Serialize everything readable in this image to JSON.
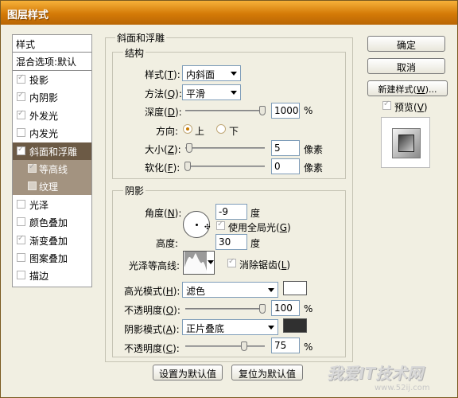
{
  "window": {
    "title": "图层样式"
  },
  "style_list": {
    "header": "样式",
    "blend_default": "混合选项:默认",
    "items": [
      {
        "label": "投影",
        "checked": true
      },
      {
        "label": "内阴影",
        "checked": true
      },
      {
        "label": "外发光",
        "checked": true
      },
      {
        "label": "内发光",
        "checked": false
      },
      {
        "label": "斜面和浮雕",
        "checked": true,
        "selected": true
      },
      {
        "label": "等高线",
        "checked": true,
        "sub": true
      },
      {
        "label": "纹理",
        "checked": false,
        "sub": true
      },
      {
        "label": "光泽",
        "checked": false
      },
      {
        "label": "颜色叠加",
        "checked": false
      },
      {
        "label": "渐变叠加",
        "checked": true
      },
      {
        "label": "图案叠加",
        "checked": false
      },
      {
        "label": "描边",
        "checked": false
      }
    ]
  },
  "bevel": {
    "group_title": "斜面和浮雕",
    "structure": {
      "title": "结构",
      "style_label": "样式(T):",
      "style_value": "内斜面",
      "technique_label": "方法(Q):",
      "technique_value": "平滑",
      "depth_label": "深度(D):",
      "depth_value": "1000",
      "depth_unit": "%",
      "depth_level": 1.0,
      "direction_label": "方向:",
      "direction_up": "上",
      "direction_down": "下",
      "size_label": "大小(Z):",
      "size_value": "5",
      "size_unit": "像素",
      "size_level": 0.02,
      "soften_label": "软化(F):",
      "soften_value": "0",
      "soften_unit": "像素",
      "soften_level": 0.0
    },
    "shading": {
      "title": "阴影",
      "angle_label": "角度(N):",
      "angle_value": "-9",
      "angle_unit": "度",
      "global_light_label": "使用全局光(G)",
      "altitude_label": "高度:",
      "altitude_value": "30",
      "altitude_unit": "度",
      "gloss_contour_label": "光泽等高线:",
      "antialias_label": "消除锯齿(L)",
      "highlight_mode_label": "高光模式(H):",
      "highlight_mode_value": "滤色",
      "highlight_color": "#ffffff",
      "highlight_opacity_label": "不透明度(O):",
      "highlight_opacity_value": "100",
      "highlight_opacity_unit": "%",
      "highlight_opacity_level": 1.0,
      "shadow_mode_label": "阴影模式(A):",
      "shadow_mode_value": "正片叠底",
      "shadow_color": "#303030",
      "shadow_opacity_label": "不透明度(C):",
      "shadow_opacity_value": "75",
      "shadow_opacity_unit": "%",
      "shadow_opacity_level": 0.75
    },
    "set_default": "设置为默认值",
    "reset_default": "复位为默认值"
  },
  "buttons": {
    "ok": "确定",
    "cancel": "取消",
    "new_style": "新建样式(W)...",
    "preview": "预览(V)"
  },
  "watermark": {
    "text": "我爱IT技术网",
    "url": "www.52ij.com"
  }
}
